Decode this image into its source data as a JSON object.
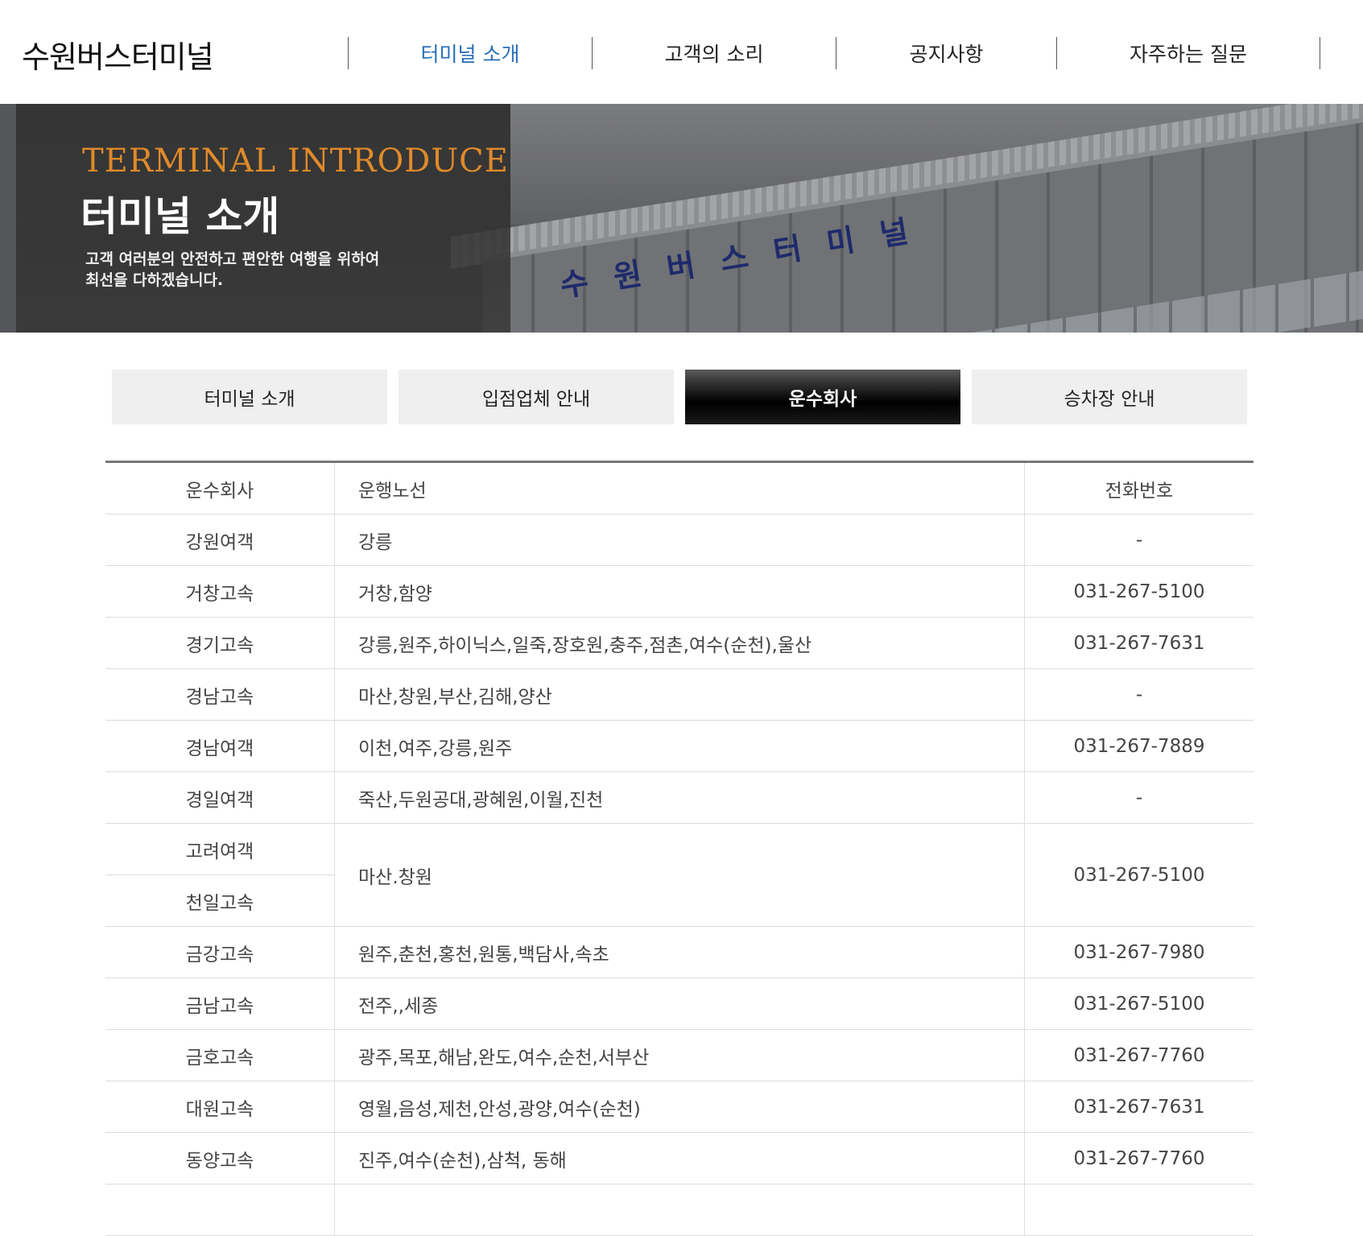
{
  "header": {
    "logo": "수원버스터미널",
    "nav": [
      {
        "label": "터미널 소개",
        "active": true
      },
      {
        "label": "고객의 소리",
        "active": false
      },
      {
        "label": "공지사항",
        "active": false
      },
      {
        "label": "자주하는 질문",
        "active": false
      }
    ]
  },
  "banner": {
    "en_title": "TERMINAL  INTRODUCE",
    "ko_title": "터미널 소개",
    "sub_line1": "고객 여러분의 안전하고 편안한 여행을 위하여",
    "sub_line2": "최선을 다하겠습니다.",
    "sign_chars": [
      "수",
      "원",
      "버",
      "스",
      "터",
      "미",
      "널"
    ]
  },
  "tabs": [
    {
      "label": "터미널 소개",
      "active": false
    },
    {
      "label": "입점업체 안내",
      "active": false
    },
    {
      "label": "운수회사",
      "active": true
    },
    {
      "label": "승차장 안내",
      "active": false
    }
  ],
  "table": {
    "headers": [
      "운수회사",
      "운행노선",
      "전화번호"
    ],
    "rows": [
      {
        "company": "강원여객",
        "route": "강릉",
        "phone": "-"
      },
      {
        "company": "거창고속",
        "route": "거창,함양",
        "phone": "031-267-5100"
      },
      {
        "company": "경기고속",
        "route": "강릉,원주,하이닉스,일죽,장호원,충주,점촌,여수(순천),울산",
        "phone": "031-267-7631"
      },
      {
        "company": "경남고속",
        "route": "마산,창원,부산,김해,양산",
        "phone": "-"
      },
      {
        "company": "경남여객",
        "route": "이천,여주,강릉,원주",
        "phone": "031-267-7889"
      },
      {
        "company": "경일여객",
        "route": "죽산,두원공대,광혜원,이월,진천",
        "phone": "-"
      },
      {
        "company": "고려여객",
        "company2": "천일고속",
        "route": "마산.창원",
        "phone": "031-267-5100"
      },
      {
        "company": "금강고속",
        "route": "원주,춘천,홍천,원통,백담사,속초",
        "phone": "031-267-7980"
      },
      {
        "company": "금남고속",
        "route": "전주,,세종",
        "phone": "031-267-5100"
      },
      {
        "company": "금호고속",
        "route": "광주,목포,해남,완도,여수,순천,서부산",
        "phone": "031-267-7760"
      },
      {
        "company": "대원고속",
        "route": "영월,음성,제천,안성,광양,여수(순천)",
        "phone": "031-267-7631"
      },
      {
        "company": "동양고속",
        "route": "진주,여수(순천),삼척, 동해",
        "phone": "031-267-7760"
      }
    ]
  }
}
